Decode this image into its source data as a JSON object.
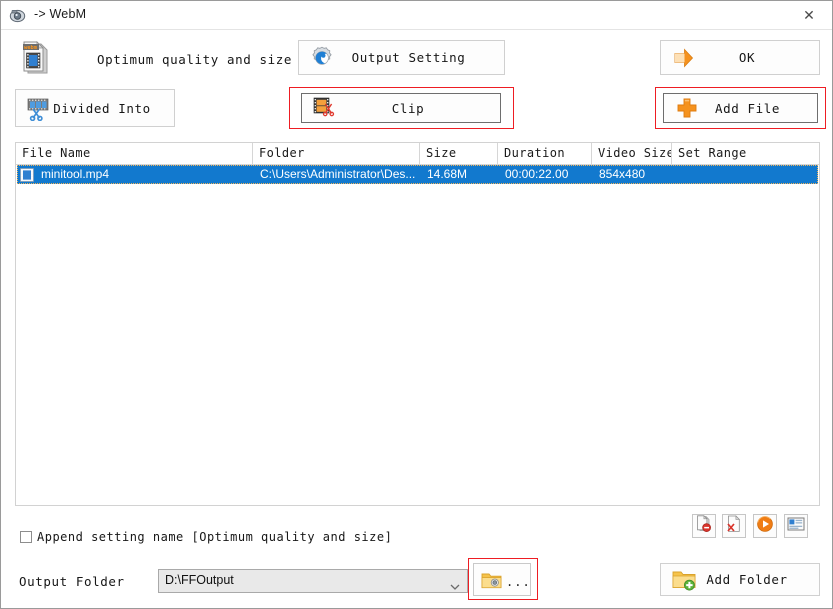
{
  "window": {
    "title": "-> WebM",
    "title_icon": "app-camera-icon",
    "close_label": "✕"
  },
  "preset": {
    "icon": "webm-file-icon",
    "label": "Optimum quality and size"
  },
  "toolbar": {
    "buttons": [
      {
        "key": "divided_into",
        "label": "Divided Into",
        "icon": "film-scissors-blue-icon",
        "highlighted": false
      },
      {
        "key": "output_setting",
        "label": "Output Setting",
        "icon": "gear-blue-icon",
        "highlighted": false
      },
      {
        "key": "clip",
        "label": "Clip",
        "icon": "film-scissors-orange-icon",
        "highlighted": true
      },
      {
        "key": "ok",
        "label": "OK",
        "icon": "orange-arrow-right-icon",
        "highlighted": false
      },
      {
        "key": "add_file",
        "label": "Add File",
        "icon": "orange-plus-icon",
        "highlighted": true
      }
    ]
  },
  "file_table": {
    "columns": [
      {
        "key": "file_name",
        "label": "File Name"
      },
      {
        "key": "folder",
        "label": "Folder"
      },
      {
        "key": "size",
        "label": "Size"
      },
      {
        "key": "duration",
        "label": "Duration"
      },
      {
        "key": "video_size",
        "label": "Video Size"
      },
      {
        "key": "set_range",
        "label": "Set Range"
      }
    ],
    "rows": [
      {
        "selected": true,
        "icon": "video-file-icon",
        "file_name": "minitool.mp4",
        "folder": "C:\\Users\\Administrator\\Des...",
        "size": "14.68M",
        "duration": "00:00:22.00",
        "video_size": "854x480",
        "set_range": ""
      }
    ]
  },
  "list_actions": [
    {
      "key": "remove_file",
      "icon": "page-remove-icon",
      "tooltip": "Remove file"
    },
    {
      "key": "clear_list",
      "icon": "page-delete-icon",
      "tooltip": "Clear list"
    },
    {
      "key": "preview_play",
      "icon": "play-circle-icon",
      "tooltip": "Play"
    },
    {
      "key": "file_info",
      "icon": "info-panel-icon",
      "tooltip": "File information"
    }
  ],
  "append_setting": {
    "checked": false,
    "label": "Append setting name [Optimum quality and size]"
  },
  "output_folder": {
    "label": "Output Folder",
    "value": "D:\\FFOutput",
    "placeholder": "D:\\FFOutput",
    "browse_label": "...",
    "browse_icon": "folder-browse-icon",
    "browse_highlighted": true,
    "add_folder_label": "Add Folder",
    "add_folder_icon": "folder-add-icon"
  },
  "colors": {
    "window_bg": "#ffffff",
    "selection_blue": "#1279ce",
    "highlight_red": "#ee1d23",
    "accent_orange": "#f59025",
    "border_gray": "#d0d0d0"
  }
}
